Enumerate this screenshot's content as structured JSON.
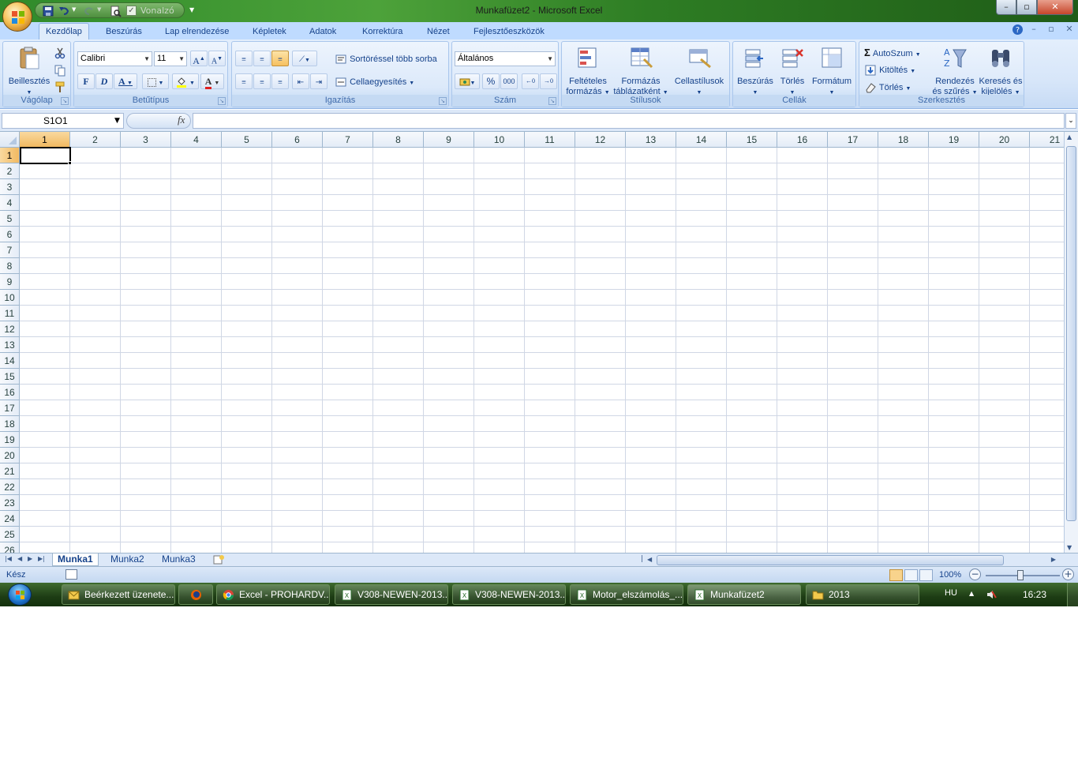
{
  "window": {
    "title": "Munkafüzet2 - Microsoft Excel",
    "min": "–",
    "max": "▫",
    "close": "✕"
  },
  "qat": {
    "dropdown_label": "Vonalzó"
  },
  "tabs": [
    "Kezdőlap",
    "Beszúrás",
    "Lap elrendezése",
    "Képletek",
    "Adatok",
    "Korrektúra",
    "Nézet",
    "Fejlesztőeszközök"
  ],
  "ribbon": {
    "clipboard": {
      "paste": "Beillesztés",
      "label": "Vágólap"
    },
    "font": {
      "name": "Calibri",
      "size": "11",
      "bold": "F",
      "italic": "D",
      "underline": "A",
      "label": "Betűtípus"
    },
    "alignment": {
      "wrap": "Sortöréssel több sorba",
      "merge": "Cellaegyesítés",
      "label": "Igazítás"
    },
    "number": {
      "format": "Általános",
      "percent": "%",
      "thousands": "000",
      "label": "Szám"
    },
    "styles": {
      "conditional_1": "Feltételes",
      "conditional_2": "formázás",
      "table_1": "Formázás",
      "table_2": "táblázatként",
      "cellstyles": "Cellastílusok",
      "label": "Stílusok"
    },
    "cells": {
      "insert": "Beszúrás",
      "delete": "Törlés",
      "format": "Formátum",
      "label": "Cellák"
    },
    "editing": {
      "autosum": "AutoSzum",
      "fill": "Kitöltés",
      "clear": "Törlés",
      "sort_1": "Rendezés",
      "sort_2": "és szűrés",
      "find_1": "Keresés és",
      "find_2": "kijelölés",
      "label": "Szerkesztés"
    }
  },
  "formula_bar": {
    "name_box": "S1O1",
    "fx": "fx"
  },
  "grid": {
    "columns": [
      "1",
      "2",
      "3",
      "4",
      "5",
      "6",
      "7",
      "8",
      "9",
      "10",
      "11",
      "12",
      "13",
      "14",
      "15",
      "16",
      "17",
      "18",
      "19",
      "20",
      "21"
    ],
    "rows": [
      "1",
      "2",
      "3",
      "4",
      "5",
      "6",
      "7",
      "8",
      "9",
      "10",
      "11",
      "12",
      "13",
      "14",
      "15",
      "16",
      "17",
      "18",
      "19",
      "20",
      "21",
      "22",
      "23",
      "24",
      "25",
      "26"
    ]
  },
  "sheets": [
    "Munka1",
    "Munka2",
    "Munka3"
  ],
  "status": {
    "text": "Kész",
    "zoom": "100%",
    "zoom_minus": "−",
    "zoom_plus": "+"
  },
  "taskbar": {
    "items": [
      "Beérkezett üzenete...",
      "",
      "Excel - PROHARDV...",
      "V308-NEWEN-2013...",
      "V308-NEWEN-2013...",
      "Motor_elszámolás_...",
      "Munkafüzet2",
      "2013"
    ],
    "lang": "HU",
    "time": "16:23"
  },
  "colors": {
    "title_green": "#2f8a2a",
    "ribbon_blue": "#dfecfb",
    "selected_header": "#f1b961",
    "gridline": "#d0d7e5"
  }
}
